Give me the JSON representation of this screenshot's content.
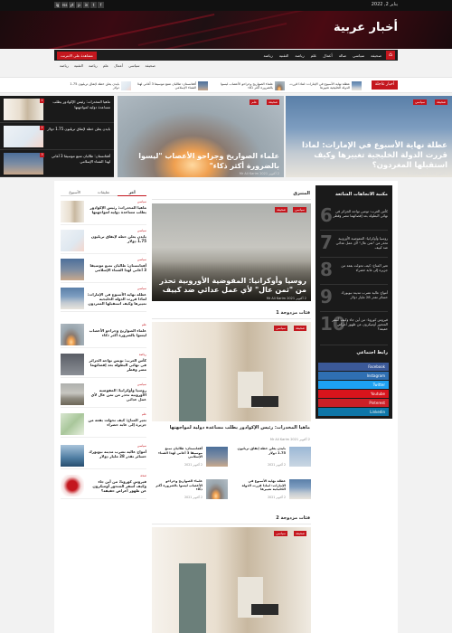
{
  "topbar": {
    "date": "يناير 2, 2022",
    "socials": [
      "f",
      "t",
      "in",
      "p",
      "yt",
      "rss",
      "ig",
      "li"
    ]
  },
  "site": {
    "title": "أخبار عربية"
  },
  "nav": {
    "home_icon": "home-icon",
    "items": [
      "صحيفة",
      "سياسي",
      "صالة",
      "أعمال",
      "علم",
      "رياضة",
      "التقنية",
      "رياضة"
    ],
    "items_rtl": [
      "صحيفة",
      "سياسي",
      "أعمال",
      "علم",
      "رياضة",
      "التقنية",
      "رياضة"
    ],
    "cta": "مشاهدة على الانترنت"
  },
  "subnav": [
    "صحيفة",
    "سياسي",
    "أعمال",
    "علم",
    "رياضة",
    "التقنية",
    "رياضة"
  ],
  "ticker": {
    "label": "أخبار عاجلة",
    "items": [
      "عطلة نهاية الأسبوع في الإمارات: لماذا قررت الدولة الخليجية تغييرها",
      "علماء الصواريخ وجراحو الأعصاب ليسوا بالضرورة أكثر ذكاء",
      "أفغانستان: طالبان تمنع موسيقا 3 أغاني لهذا الشتاء الإسلامي",
      "بايدن يعلن خطة لإنفاق تريليون 1.75 دولار",
      "ماهيا المخدرات: رئيس الإكوادور يطلب مساعدة دولية لمواجهتها"
    ]
  },
  "hero": {
    "big1": {
      "title": "عطلة نهاية الأسبوع في الإمارات: لماذا قررت الدولة الخليجية تغييرها وكيف استقبلها المغردون؟",
      "tags": [
        "صحيفة",
        "سياسي"
      ],
      "meta": "2 أكتوبر 2021   Mr Ali Karim"
    },
    "big2": {
      "title": "علماء الصواريخ وجراحو الأعصاب \"ليسوا بالضرورة أكثر ذكاء\"",
      "tags": [
        "صحيفة",
        "علم"
      ],
      "meta": "2 أكتوبر 2021   Mr Ali Karim"
    },
    "side": [
      "ماهيا المخدرات: رئيس الإكوادور يطلب مساعدة دولية لمواجهتها",
      "بايدن يعلن خطة لإنفاق تريليون 1.75 دولار",
      "أفغانستان: طالبان تمنع موسيقا 3 أغاني لهذا الشتاء الإسلامي"
    ]
  },
  "tabs": [
    "آخر",
    "تعليقات",
    "الأسبوع"
  ],
  "tab_counts": [
    "",
    "2",
    ""
  ],
  "left_posts": [
    {
      "cat": "سياسي",
      "title": "ماهيا المخدرات: رئيس الإكوادور يطلب مساعدة دولية لمواجهتها"
    },
    {
      "cat": "سياسي",
      "title": "بايدن يعلن خطة لإنفاق تريليون 1.75 دولار"
    },
    {
      "cat": "سياسي",
      "title": "أفغانستان: طالبان تمنع موسيقا 3 أغاني لهذا الشتاء الإسلامي"
    },
    {
      "cat": "سياسي",
      "title": "عطلة نهاية الأسبوع في الإمارات: لماذا قررت الدولة الخليجية تغييرها وكيف استقبلها المغردون"
    },
    {
      "cat": "علم",
      "title": "علماء الصواريخ وجراحو الأعصاب ليسوا بالضرورة أكثر ذكاء"
    },
    {
      "cat": "رياضة",
      "title": "كأس العرب: تونس تواجه الجزائر في نهائي البطولة بعد إقصائهما مصر وقطر"
    },
    {
      "cat": "سياسي",
      "title": "روسيا وأوكرانيا: المفوضية الأوروبية تحذر من تمن عال لأي عمل عدائي"
    },
    {
      "cat": "علم",
      "title": "تغير المناخ: كيف تحولت بقعة من جزيرة إلى غابة خضراء"
    },
    {
      "cat": "سياسي",
      "title": "أمواج عالية تضرب مدينة نيويورك خسائر تقدر 28 مليار دولار"
    },
    {
      "cat": "صحة",
      "title": "فيروس كورونا: من أين جاء وكيف أسفر المتحور أوميكرون عن ظهور أعراض خفيفة؟"
    }
  ],
  "center": {
    "featured_section": "المتنزق",
    "featured": {
      "title": "روسيا وأوكرانيا: المفوضية الأوروبية تحذر من \"ثمن عال\" لأي عمل عدائي ضد كييف",
      "tags": [
        "سياسي",
        "صحيفة"
      ],
      "meta": "2 أكتوبر 2021   Mr Ali Karim"
    },
    "cat1": "فئات مزدوجة 1",
    "cat1_post": {
      "title": "ماهيا المخدرات: رئيس الإكوادور يطلب مساعدة دولية لمواجهتها",
      "tags": [
        "صحيفة",
        "سياسي"
      ],
      "meta": "2 أكتوبر 2021   Mr Ali Karim"
    },
    "cat1_small": [
      {
        "title": "بايدن يعلن خطة إنفاق تريليون 1.75 دولار",
        "meta": "2 أكتوبر 2021"
      },
      {
        "title": "أفغانستان: طالبان تمنع موسيقا 3 أغاني لهذا الشتاء الإسلامي",
        "meta": "2 أكتوبر 2021"
      },
      {
        "title": "عطلة نهاية الأسبوع في الإمارات: لماذا قررت الدولة الخليجية تغييرها",
        "meta": "2 أكتوبر 2021"
      },
      {
        "title": "علماء الصواريخ وجراحو الأعصاب ليسوا بالضرورة أكثر ذكاء",
        "meta": "2 أكتوبر 2021"
      }
    ],
    "cat2": "فئات مزدوجة 2",
    "cat2_post": {
      "tags": [
        "صحيفة",
        "سياسي"
      ]
    }
  },
  "right": {
    "trending_title": "مكتبة الاتجاهات الشائعة",
    "trending": [
      {
        "num": "6",
        "title": "كأس العرب: تونس تواجه الجزائر في نهائي البطولة بعد إقصائهما مصر وقطر"
      },
      {
        "num": "7",
        "title": "روسيا وأوكرانيا: المفوضية الأوروبية تحذر من \"ثمن عال\" لأي عمل عدائي ضد كييف"
      },
      {
        "num": "8",
        "title": "تغير المناخ: كيف تحولت بقعة من جزيرة إلى غابة خضراء"
      },
      {
        "num": "9",
        "title": "أمواج عالية تضرب مدينة نيويورك خسائر تقدر 28 مليار دولار"
      },
      {
        "num": "10",
        "title": "فيروس كورونا: من أين جاء وكيف أسفر المتحور أوميكرون عن ظهور أعراض خفيفة؟"
      }
    ],
    "social_title": "رابط اجتماعي",
    "social": [
      {
        "label": "Facebook",
        "color": "#3b5998"
      },
      {
        "label": "Instagram",
        "color": "#2f6fb2"
      },
      {
        "label": "Twitter",
        "color": "#1da1f2"
      },
      {
        "label": "Youtube",
        "color": "#d8141c"
      },
      {
        "label": "Pinterest",
        "color": "#cb2027"
      },
      {
        "label": "Linkedin",
        "color": "#0e76a8"
      }
    ]
  },
  "colors": {
    "accent": "#c4171e",
    "dark": "#1a1a1a"
  }
}
